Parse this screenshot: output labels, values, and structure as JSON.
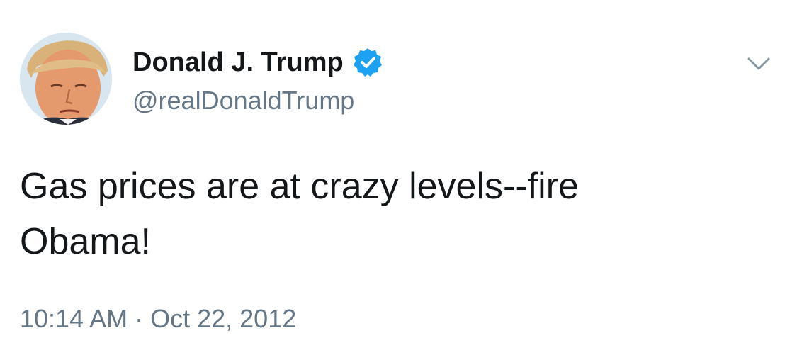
{
  "tweet": {
    "author": {
      "display_name": "Donald J. Trump",
      "handle": "@realDonaldTrump",
      "verified": true,
      "avatar_icon": "profile-photo"
    },
    "text_line1": "Gas prices are at crazy levels--fire",
    "text_line2": "Obama!",
    "time": "10:14 AM",
    "separator": "·",
    "date": "Oct 22, 2012",
    "menu_icon": "chevron-down-icon"
  },
  "colors": {
    "text_primary": "#14171a",
    "text_secondary": "#657786",
    "verified_blue": "#1da1f2",
    "caret_gray": "#8899a6"
  }
}
